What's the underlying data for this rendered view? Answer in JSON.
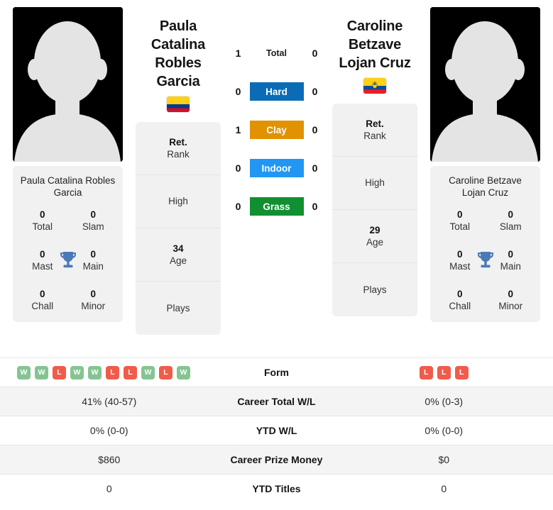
{
  "colors": {
    "hard": "#0a6cb6",
    "clay": "#e09200",
    "indoor": "#2196f3",
    "grass": "#109030",
    "win_badge": "#85c492",
    "loss_badge": "#f15b4a",
    "trophy": "#4a7ab5",
    "card_bg": "#f1f1f1",
    "row_shade": "#f4f4f4"
  },
  "players": {
    "left": {
      "name": "Paula Catalina Robles Garcia",
      "flag": "colombia-flag",
      "avatar": "player-avatar-placeholder",
      "awards": {
        "title": "Paula Catalina Robles Garcia",
        "cells": [
          {
            "value": "0",
            "label": "Total"
          },
          {
            "value": "0",
            "label": "Slam"
          },
          {
            "value": "0",
            "label": "Mast"
          },
          {
            "value": "0",
            "label": "Main"
          },
          {
            "value": "0",
            "label": "Chall"
          },
          {
            "value": "0",
            "label": "Minor"
          }
        ],
        "trophy_icon": "trophy-icon"
      },
      "info": [
        {
          "value": "Ret.",
          "label": "Rank"
        },
        {
          "value": "",
          "label": "High"
        },
        {
          "value": "34",
          "label": "Age"
        },
        {
          "value": "",
          "label": "Plays"
        }
      ]
    },
    "right": {
      "name": "Caroline Betzave Lojan Cruz",
      "flag": "ecuador-flag",
      "avatar": "player-avatar-placeholder",
      "awards": {
        "title": "Caroline Betzave Lojan Cruz",
        "cells": [
          {
            "value": "0",
            "label": "Total"
          },
          {
            "value": "0",
            "label": "Slam"
          },
          {
            "value": "0",
            "label": "Mast"
          },
          {
            "value": "0",
            "label": "Main"
          },
          {
            "value": "0",
            "label": "Chall"
          },
          {
            "value": "0",
            "label": "Minor"
          }
        ],
        "trophy_icon": "trophy-icon"
      },
      "info": [
        {
          "value": "Ret.",
          "label": "Rank"
        },
        {
          "value": "",
          "label": "High"
        },
        {
          "value": "29",
          "label": "Age"
        },
        {
          "value": "",
          "label": "Plays"
        }
      ]
    }
  },
  "h2h": [
    {
      "label": "Total",
      "left": "1",
      "right": "0",
      "surface": "total"
    },
    {
      "label": "Hard",
      "left": "0",
      "right": "0",
      "surface": "hard"
    },
    {
      "label": "Clay",
      "left": "1",
      "right": "0",
      "surface": "clay"
    },
    {
      "label": "Indoor",
      "left": "0",
      "right": "0",
      "surface": "indoor"
    },
    {
      "label": "Grass",
      "left": "0",
      "right": "0",
      "surface": "grass"
    }
  ],
  "stats": {
    "form": {
      "label": "Form",
      "left": [
        "W",
        "W",
        "L",
        "W",
        "W",
        "L",
        "L",
        "W",
        "L",
        "W"
      ],
      "right": [
        "L",
        "L",
        "L"
      ]
    },
    "rows": [
      {
        "label": "Career Total W/L",
        "left": "41% (40-57)",
        "right": "0% (0-3)"
      },
      {
        "label": "YTD W/L",
        "left": "0% (0-0)",
        "right": "0% (0-0)"
      },
      {
        "label": "Career Prize Money",
        "left": "$860",
        "right": "$0"
      },
      {
        "label": "YTD Titles",
        "left": "0",
        "right": "0"
      }
    ]
  }
}
